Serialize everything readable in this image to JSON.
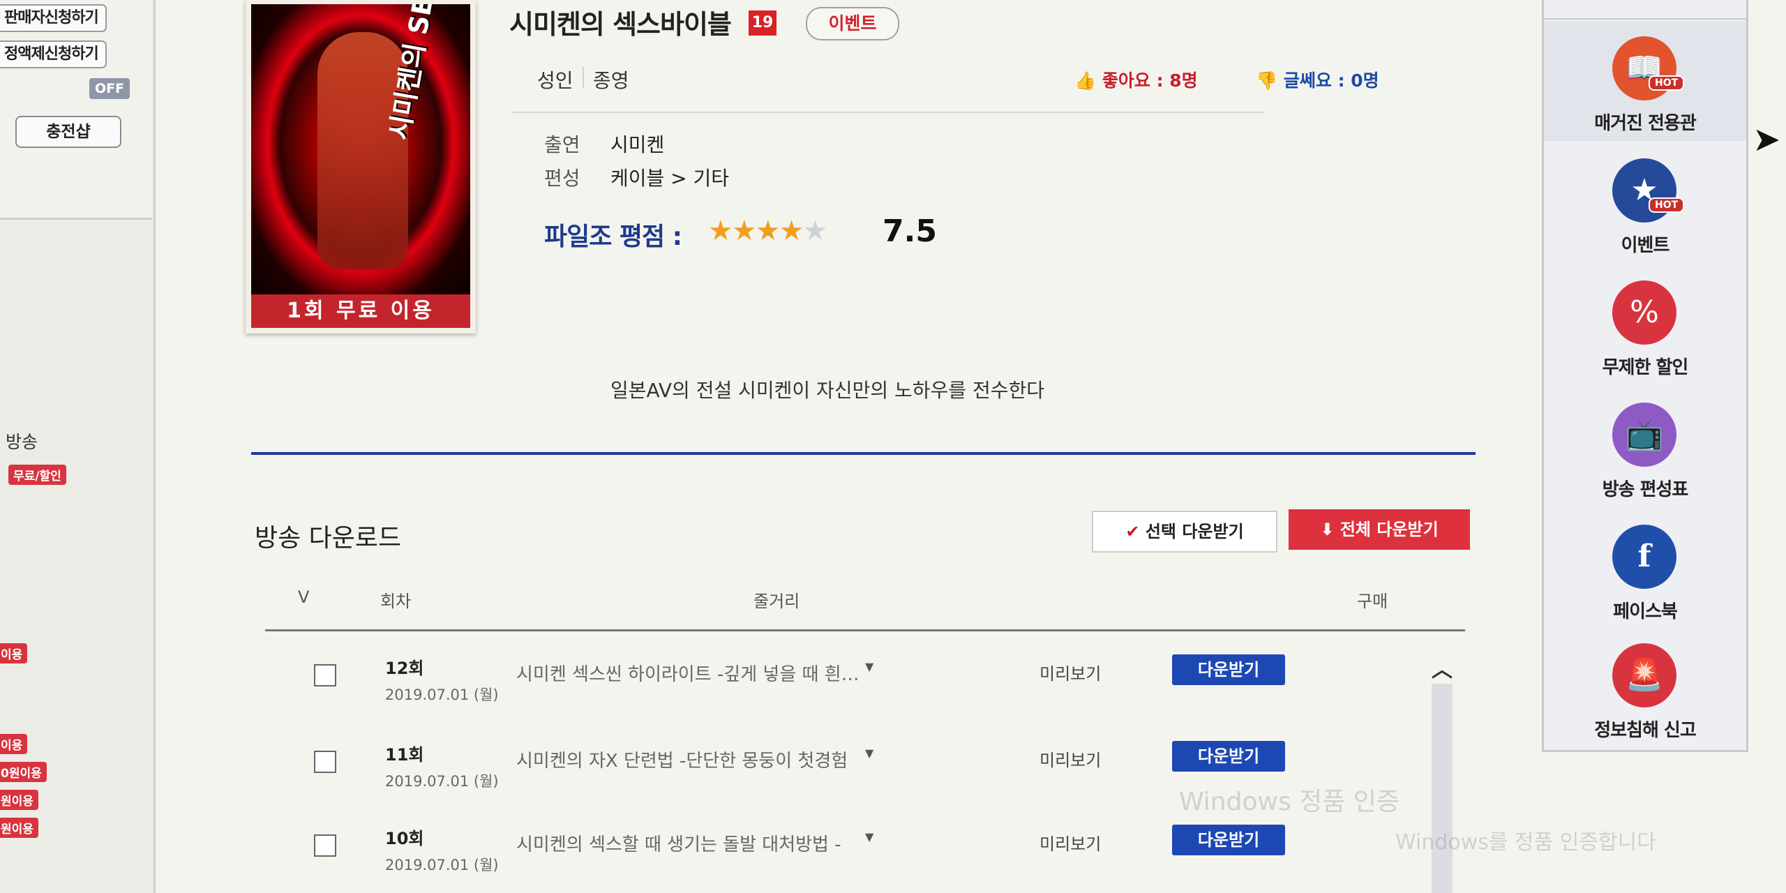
{
  "left_sidebar": {
    "seller_apply": "판매자신청하기",
    "policy_apply": "정액제신청하기",
    "off_toggle": "OFF",
    "charge_button": "충전샵",
    "broadcast_label": "방송",
    "free_discount_badge": "무료/할인",
    "badges_cut": [
      "이용",
      "이용",
      "0원이용",
      "원이용",
      "원이용"
    ]
  },
  "content": {
    "poster_free_label": "1회 무료 이용",
    "poster_art_text": "시미켄의 SEX바이블",
    "title": "시미켄의 섹스바이블",
    "age_badge": "19",
    "event_chip": "이벤트",
    "genre_adult": "성인",
    "genre_ended": "종영",
    "likes_text": "좋아요 : 8명",
    "comments_text": "글쎄요 : 0명",
    "cast_label": "출연",
    "cast_value": "시미켄",
    "category_label": "편성",
    "category_value": "케이블 > 기타",
    "rating_label": "파일조 평점 :",
    "rating_score": "7.5",
    "rating_stars": 4,
    "description": "일본AV의 전설 시미켄이 자신만의 노하우를 전수한다"
  },
  "download": {
    "section_title": "방송 다운로드",
    "select_download": "선택 다운받기",
    "all_download": "전체 다운받기",
    "columns": {
      "check": "V",
      "episode": "회차",
      "summary": "줄거리",
      "purchase": "구매"
    },
    "rows": [
      {
        "episode": "12회",
        "date": "2019.07.01 (월)",
        "summary": "시미켄 섹스씬 하이라이트 -깊게 넣을 때 흰…",
        "preview": "미리보기",
        "download": "다운받기"
      },
      {
        "episode": "11회",
        "date": "2019.07.01 (월)",
        "summary": "시미켄의 자X 단련법 -단단한 몽둥이 첫경험",
        "preview": "미리보기",
        "download": "다운받기"
      },
      {
        "episode": "10회",
        "date": "2019.07.01 (월)",
        "summary": "시미켄의 섹스할 때 생기는 돌발 대처방법 -",
        "preview": "미리보기",
        "download": "다운받기"
      }
    ]
  },
  "quick_menu": {
    "items": [
      {
        "label": "매거진 전용관",
        "hot": "HOT",
        "icon": "book-icon",
        "color": "#e2542d"
      },
      {
        "label": "이벤트",
        "hot": "HOT",
        "icon": "event-icon",
        "color": "#254a9a"
      },
      {
        "label": "무제한 할인",
        "hot": "",
        "icon": "percent-icon",
        "color": "#d8343f"
      },
      {
        "label": "방송 편성표",
        "hot": "",
        "icon": "tv-icon",
        "color": "#8e5bc4"
      },
      {
        "label": "페이스북",
        "hot": "",
        "icon": "facebook-icon",
        "color": "#1f4fa8"
      },
      {
        "label": "정보침해 신고",
        "hot": "",
        "icon": "siren-icon",
        "color": "#d8343f"
      }
    ]
  },
  "watermark": "Windows 정품 인증",
  "watermark_sub": "Windows를 정품 인증합니다"
}
